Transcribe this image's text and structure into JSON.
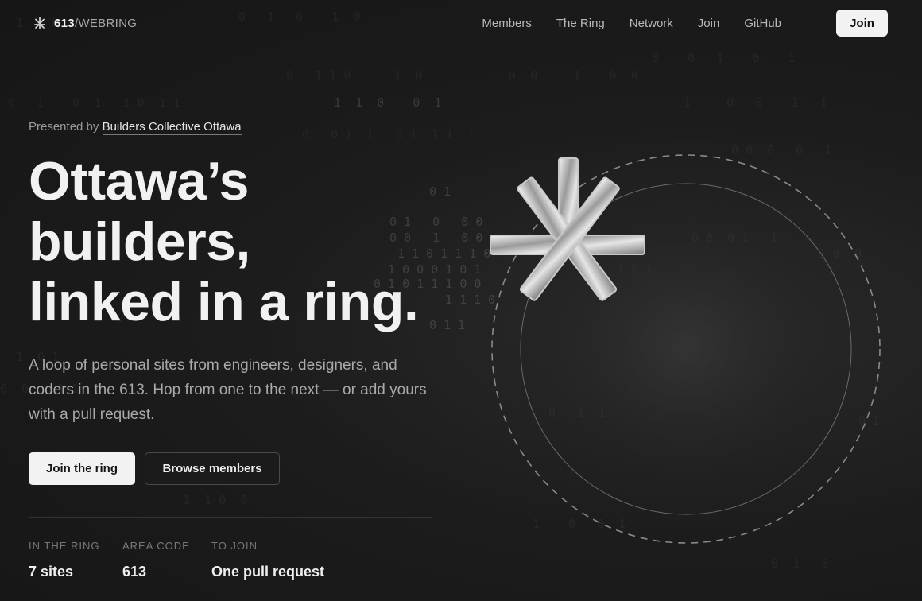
{
  "nav": {
    "brand_num": "613",
    "brand_rest": "/WEBRING",
    "links": [
      "Members",
      "The Ring",
      "Network",
      "Join",
      "GitHub"
    ],
    "cta": "Join"
  },
  "hero": {
    "presented_prefix": "Presented by",
    "presented_link": "Builders Collective Ottawa",
    "headline": [
      "Ottawa’s",
      "builders,",
      "linked in a ring."
    ],
    "subtext": "A loop of personal sites from engineers, designers, and coders in the 613. Hop from one to the next — or add yours with a pull request.",
    "primary_button": "Join the ring",
    "secondary_button": "Browse members"
  },
  "stats": [
    {
      "label": "IN THE RING",
      "value": "7 sites"
    },
    {
      "label": "AREA CODE",
      "value": "613"
    },
    {
      "label": "TO JOIN",
      "value": "One pull request"
    }
  ],
  "icons": {
    "brand": "asterisk-icon",
    "center": "asterisk-emblem-icon"
  },
  "colors": {
    "background": "#1a1a1a",
    "primary_button_bg": "#f2f2f2",
    "text": "#f1f1f1",
    "muted_text": "#a9a9a9"
  }
}
